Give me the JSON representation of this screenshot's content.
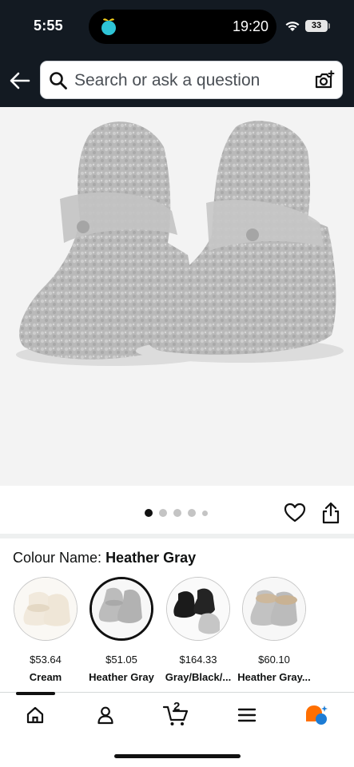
{
  "status_bar": {
    "time": "5:55",
    "island_time": "19:20",
    "battery": "33",
    "icons": [
      "wifi-icon",
      "battery-icon",
      "app-icon"
    ]
  },
  "search": {
    "placeholder": "Search or ask a question",
    "icons": [
      "back-arrow-icon",
      "search-icon",
      "camera-icon"
    ]
  },
  "gallery": {
    "image": "gray-fleece-baby-booties",
    "dot_count": 5,
    "active_index": 0,
    "icons": [
      "heart-icon",
      "share-icon"
    ]
  },
  "colour": {
    "label": "Colour Name:",
    "selected": "Heather Gray",
    "options": [
      {
        "price": "$53.64",
        "name": "Cream",
        "selected": false,
        "color": "#f3ece0"
      },
      {
        "price": "$51.05",
        "name": "Heather Gray",
        "selected": true,
        "color": "#bdbdbd"
      },
      {
        "price": "$164.33",
        "name": "Gray/Black/...",
        "selected": false,
        "color": "#1a1a1a"
      },
      {
        "price": "$60.10",
        "name": "Heather Gray...",
        "selected": false,
        "color": "#c9b49a"
      }
    ]
  },
  "bottom_nav": {
    "items": [
      "home-icon",
      "account-icon",
      "cart-icon",
      "menu-icon",
      "rufus-icon"
    ],
    "cart_count": "2",
    "active": "home-icon"
  },
  "colors": {
    "header_bg": "#131a22",
    "accent": "#ff6f00",
    "accent_blue": "#1c7cd5"
  }
}
